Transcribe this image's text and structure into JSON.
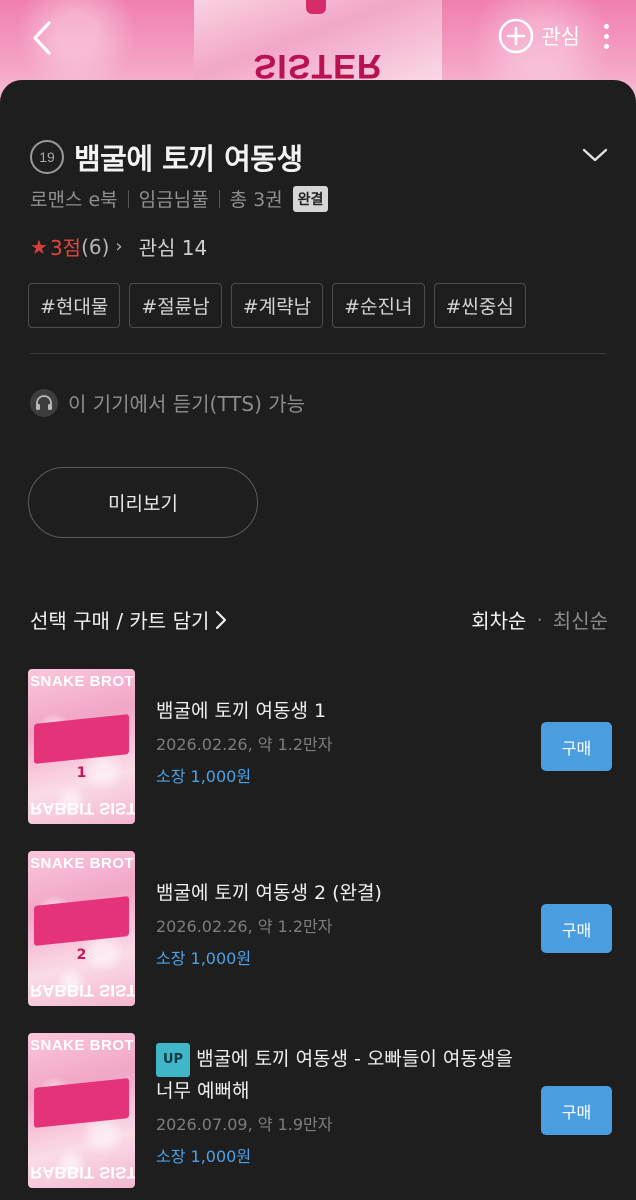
{
  "banner": {
    "cover_text": "RABBIT SISTER",
    "interest_label": "관심"
  },
  "header": {
    "age_rating": "19",
    "title": "뱀굴에 토끼 여동생",
    "genre": "로맨스 e북",
    "author": "임금님풀",
    "volumes": "총 3권",
    "status_badge": "완결"
  },
  "rating": {
    "score": "3점",
    "count": "(6)",
    "interest": "관심 14"
  },
  "tags": [
    "#현대물",
    "#절륜남",
    "#계략남",
    "#순진녀",
    "#씬중심"
  ],
  "tts": {
    "text": "이 기기에서 듣기(TTS) 가능"
  },
  "preview": {
    "label": "미리보기"
  },
  "list": {
    "select_buy_label": "선택 구매 / 카트 담기",
    "sort_active": "회차순",
    "sort_inactive": "최신순"
  },
  "episodes": [
    {
      "title": "뱀굴에 토끼 여동생 1",
      "up": "",
      "date": "2026.02.26, 약 1.2만자",
      "price": "소장 1,000원",
      "buy_label": "구매",
      "thumb_top": "SNAKE BROTHER",
      "thumb_bottom": "RABBIT SISTER",
      "thumb_num": "1"
    },
    {
      "title": "뱀굴에 토끼 여동생 2 (완결)",
      "up": "",
      "date": "2026.02.26, 약 1.2만자",
      "price": "소장 1,000원",
      "buy_label": "구매",
      "thumb_top": "SNAKE BROTHER",
      "thumb_bottom": "RABBIT SISTER",
      "thumb_num": "2"
    },
    {
      "title": "뱀굴에 토끼 여동생 - 오빠들이 여동생을 너무 예뻐해",
      "up": "UP",
      "date": "2026.07.09, 약 1.9만자",
      "price": "소장 1,000원",
      "buy_label": "구매",
      "thumb_top": "SNAKE BROTHER",
      "thumb_bottom": "RABBIT SISTER",
      "thumb_num": ""
    }
  ],
  "colors": {
    "accent_blue": "#4a9ee0",
    "rating_red": "#e2453c",
    "up_badge": "#3fb7c9",
    "banner_pink": "#f07fae"
  }
}
